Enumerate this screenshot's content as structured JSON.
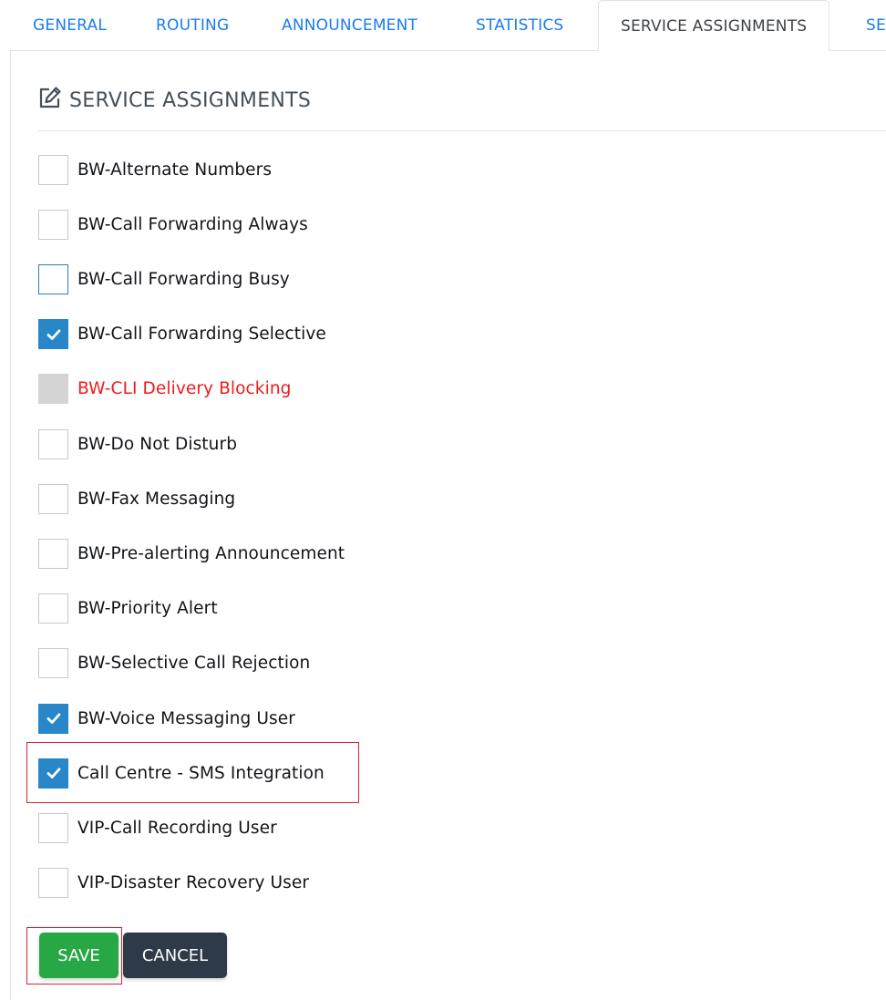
{
  "tabs": [
    {
      "label": "GENERAL",
      "active": false
    },
    {
      "label": "ROUTING",
      "active": false
    },
    {
      "label": "ANNOUNCEMENT",
      "active": false
    },
    {
      "label": "STATISTICS",
      "active": false
    },
    {
      "label": "SERVICE ASSIGNMENTS",
      "active": true
    },
    {
      "label": "SE",
      "active": false
    }
  ],
  "section": {
    "title": "SERVICE ASSIGNMENTS",
    "icon": "edit-icon"
  },
  "services": [
    {
      "label": "BW-Alternate Numbers",
      "state": "unchecked"
    },
    {
      "label": "BW-Call Forwarding Always",
      "state": "unchecked"
    },
    {
      "label": "BW-Call Forwarding Busy",
      "state": "unchecked-focused"
    },
    {
      "label": "BW-Call Forwarding Selective",
      "state": "checked"
    },
    {
      "label": "BW-CLI Delivery Blocking",
      "state": "disabled"
    },
    {
      "label": "BW-Do Not Disturb",
      "state": "unchecked"
    },
    {
      "label": "BW-Fax Messaging",
      "state": "unchecked"
    },
    {
      "label": "BW-Pre-alerting Announcement",
      "state": "unchecked"
    },
    {
      "label": "BW-Priority Alert",
      "state": "unchecked"
    },
    {
      "label": "BW-Selective Call Rejection",
      "state": "unchecked"
    },
    {
      "label": "BW-Voice Messaging User",
      "state": "checked"
    },
    {
      "label": "Call Centre - SMS Integration",
      "state": "checked",
      "highlighted": true
    },
    {
      "label": "VIP-Call Recording User",
      "state": "unchecked"
    },
    {
      "label": "VIP-Disaster Recovery User",
      "state": "unchecked"
    }
  ],
  "actions": {
    "save_label": "SAVE",
    "cancel_label": "CANCEL",
    "save_highlighted": true
  },
  "colors": {
    "tab_link": "#1a7cf0",
    "checked": "#2787c9",
    "disabled_text": "#ee1c1c",
    "save": "#28a745",
    "cancel": "#2e3a48",
    "highlight": "#d9222a"
  }
}
